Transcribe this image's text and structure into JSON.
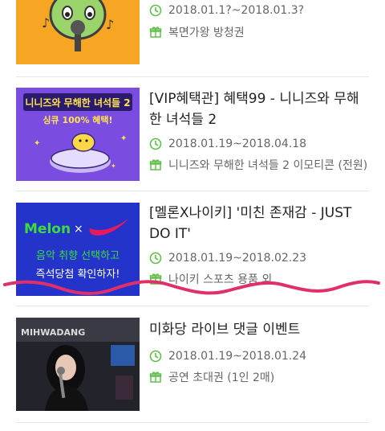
{
  "events": [
    {
      "title": "",
      "date": "2018.01.1?~2018.01.3?",
      "reward": "복면가왕 방청권",
      "thumb_text": []
    },
    {
      "title": "[VIP혜택관] 혜택99 - 니니즈와 무해한 녀석들 2",
      "date": "2018.01.19~2018.04.18",
      "reward": "니니즈와 무해한 녀석들 2 이모티콘 (전원)",
      "thumb_text": [
        "니니즈와 무해한 녀석들 2",
        "싱큐 100% 혜택!"
      ]
    },
    {
      "title": "[멜론X나이키] '미친 존재감 - JUST DO IT'",
      "date": "2018.01.19~2018.02.23",
      "reward": "나이키 스포츠 용품 외",
      "thumb_text": [
        "Melon",
        "×",
        "음악 취향 선택하고",
        "즉석당첨 확인하자!"
      ]
    },
    {
      "title": "미화당 라이브 댓글 이벤트",
      "date": "2018.01.19~2018.01.24",
      "reward": "공연 초대권 (1인 2매)",
      "thumb_text": [
        "MIHWADANG"
      ]
    }
  ],
  "colors": {
    "accent_green": "#5fbf4a",
    "thumb1_bg": "#f6a623",
    "thumb2_bg": "#7a4de0",
    "thumb3_bg": "#2433c9",
    "squiggle": "#e0306a"
  },
  "icons": [
    "clock-icon",
    "gift-icon",
    "nike-swoosh-icon",
    "microphone-icon"
  ]
}
